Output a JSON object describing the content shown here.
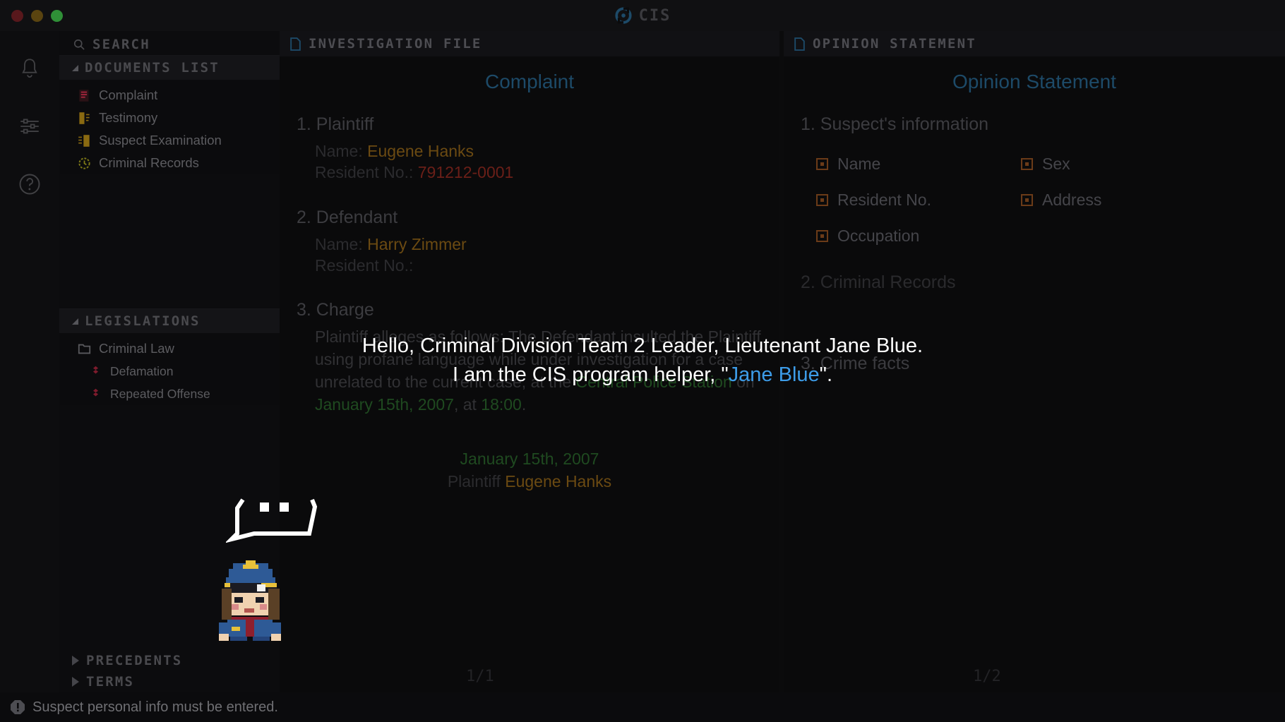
{
  "window": {
    "title": "CIS",
    "logo_icon": "refresh-circle-icon",
    "buttons": {
      "close": "close-button",
      "minimize": "minimize-button",
      "maximize": "maximize-button"
    }
  },
  "rail": {
    "items": [
      {
        "name": "notifications",
        "icon": "bell-icon"
      },
      {
        "name": "settings",
        "icon": "sliders-icon"
      },
      {
        "name": "help",
        "icon": "question-mark-icon"
      }
    ]
  },
  "sidebar": {
    "search": {
      "icon": "search-icon",
      "label": "SEARCH"
    },
    "documents": {
      "label": "DOCUMENTS LIST",
      "caret": "caret-down-icon",
      "items": [
        {
          "label": "Complaint",
          "icon": "complaint-doc-icon"
        },
        {
          "label": "Testimony",
          "icon": "testimony-doc-icon"
        },
        {
          "label": "Suspect Examination",
          "icon": "suspect-exam-doc-icon"
        },
        {
          "label": "Criminal Records",
          "icon": "criminal-records-doc-icon"
        }
      ]
    },
    "legislations": {
      "label": "LEGISLATIONS",
      "caret": "caret-down-icon",
      "items": [
        {
          "label": "Criminal Law",
          "icon": "folder-icon",
          "indent": false
        },
        {
          "label": "Defamation",
          "icon": "law-item-icon",
          "indent": true
        },
        {
          "label": "Repeated Offense",
          "icon": "law-item-icon",
          "indent": true
        }
      ]
    },
    "precedents": {
      "label": "PRECEDENTS",
      "caret": "caret-right-icon"
    },
    "terms": {
      "label": "TERMS",
      "caret": "caret-right-icon"
    }
  },
  "statusbar": {
    "icon": "warning-icon",
    "message": "Suspect personal info must be entered."
  },
  "left_panel": {
    "header": {
      "icon": "document-icon",
      "title": "INVESTIGATION FILE"
    },
    "doc_title": "Complaint",
    "page_indicator": "1/1",
    "sections": [
      {
        "heading": "1. Plaintiff",
        "fields": [
          {
            "label": "Name:",
            "value": "Eugene Hanks",
            "value_kind": "name"
          },
          {
            "label": "Resident No.:",
            "value": "791212-0001",
            "value_kind": "rrn"
          }
        ]
      },
      {
        "heading": "2. Defendant",
        "fields": [
          {
            "label": "Name:",
            "value": "Harry Zimmer",
            "value_kind": "name"
          },
          {
            "label": "Resident No.:",
            "value": "",
            "value_kind": "rrn"
          }
        ]
      },
      {
        "heading": "3. Charge",
        "paragraph_parts": [
          {
            "text": "Plaintiff alleges as follows: The Defendant insulted the Plaintiff using profane language while under investigation for a case unrelated to the current case, at the ",
            "kind": "plain"
          },
          {
            "text": "Central Police Station",
            "kind": "green"
          },
          {
            "text": " on ",
            "kind": "plain"
          },
          {
            "text": "January 15th, 2007",
            "kind": "green"
          },
          {
            "text": ", at ",
            "kind": "plain"
          },
          {
            "text": "18:00",
            "kind": "green"
          },
          {
            "text": ".",
            "kind": "plain"
          }
        ]
      }
    ],
    "signature": {
      "date": "January 15th, 2007",
      "role": "Plaintiff ",
      "name": "Eugene Hanks"
    }
  },
  "right_panel": {
    "header": {
      "icon": "document-icon",
      "title": "OPINION STATEMENT"
    },
    "doc_title": "Opinion Statement",
    "page_indicator": "1/2",
    "section1_heading": "1. Suspect's information",
    "checkboxes": [
      [
        "Name",
        "Sex"
      ],
      [
        "Resident No.",
        "Address"
      ],
      [
        "Occupation",
        ""
      ]
    ],
    "section2_heading": "2. Criminal Records",
    "section3_heading": "3. Crime facts"
  },
  "dialogue": {
    "line1": "Hello, Criminal Division Team 2 Leader, Lieutenant Jane Blue.",
    "line2_prefix": "I am the CIS program helper, \"",
    "line2_highlight": "Jane Blue",
    "line2_suffix": "\".",
    "highlight_color": "#3d9ce8"
  },
  "character": {
    "sprite_name": "police-officer-sprite",
    "bubble_name": "speech-bubble"
  }
}
